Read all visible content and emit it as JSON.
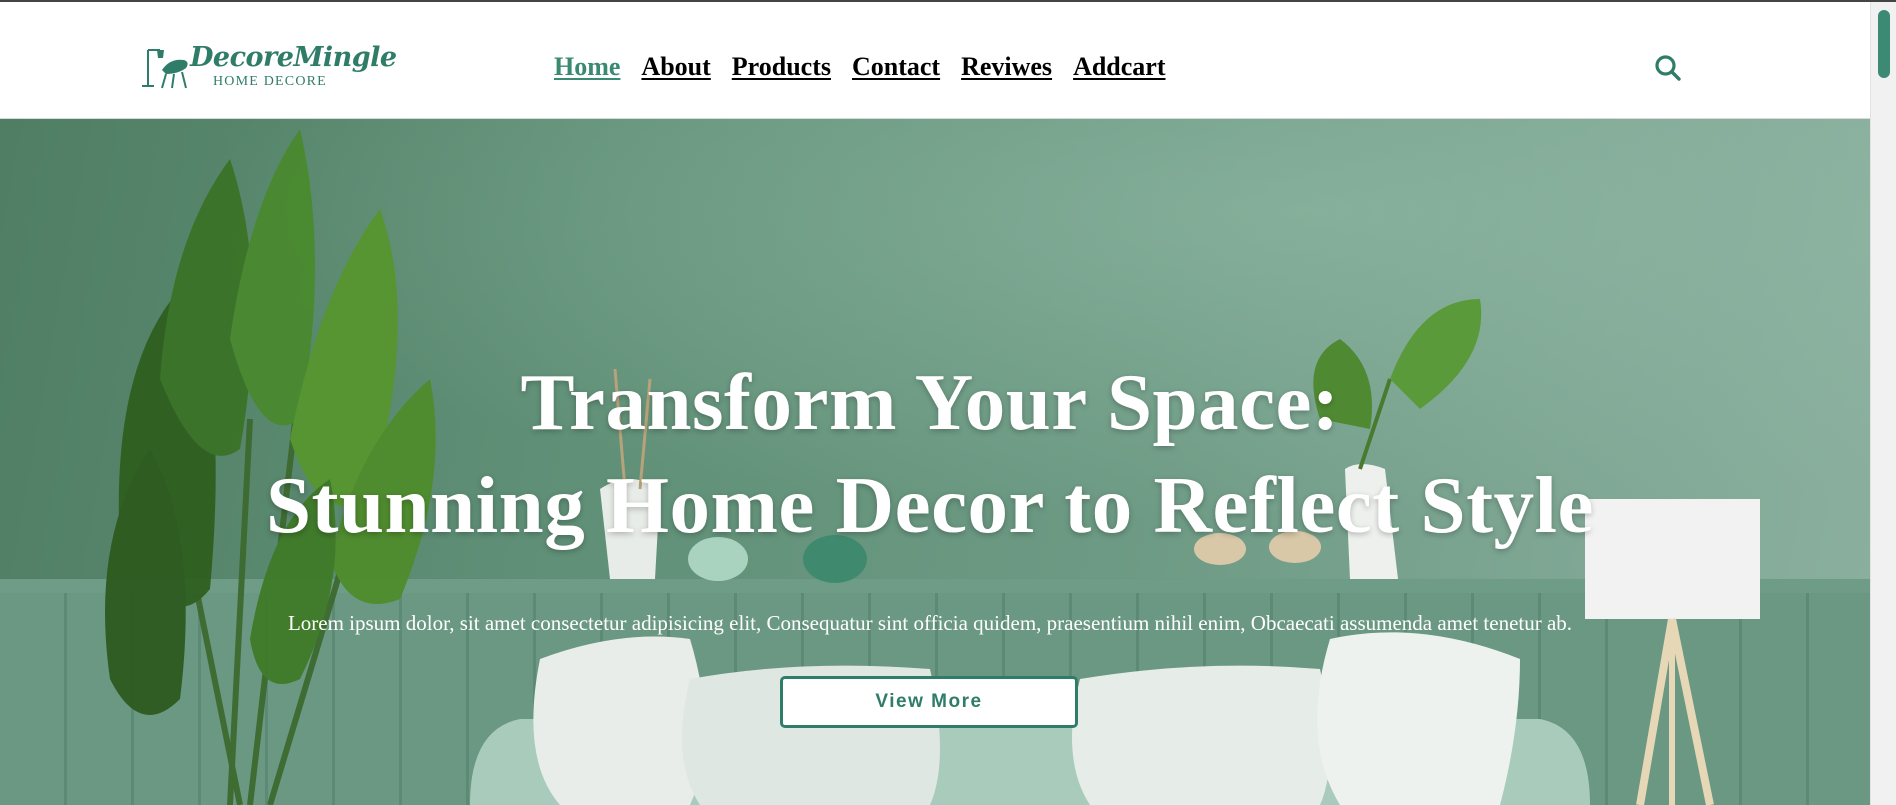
{
  "brand": {
    "name": "DecoreMingle",
    "tagline": "HOME DECORE",
    "accent": "#2f7d69"
  },
  "nav": {
    "items": [
      {
        "label": "Home",
        "active": true
      },
      {
        "label": "About",
        "active": false
      },
      {
        "label": "Products",
        "active": false
      },
      {
        "label": "Contact",
        "active": false
      },
      {
        "label": "Reviwes",
        "active": false
      },
      {
        "label": "Addcart",
        "active": false
      }
    ],
    "search_icon": "search-icon"
  },
  "hero": {
    "title_line1": "Transform Your Space:",
    "title_line2": "Stunning Home Decor to Reflect Style",
    "text": "Lorem ipsum dolor, sit amet consectetur adipisicing elit, Consequatur sint officia quidem, praesentium nihil enim, Obcaecati assumenda amet tenetur ab.",
    "button_label": "View More",
    "background_color": "#5f8f76"
  }
}
